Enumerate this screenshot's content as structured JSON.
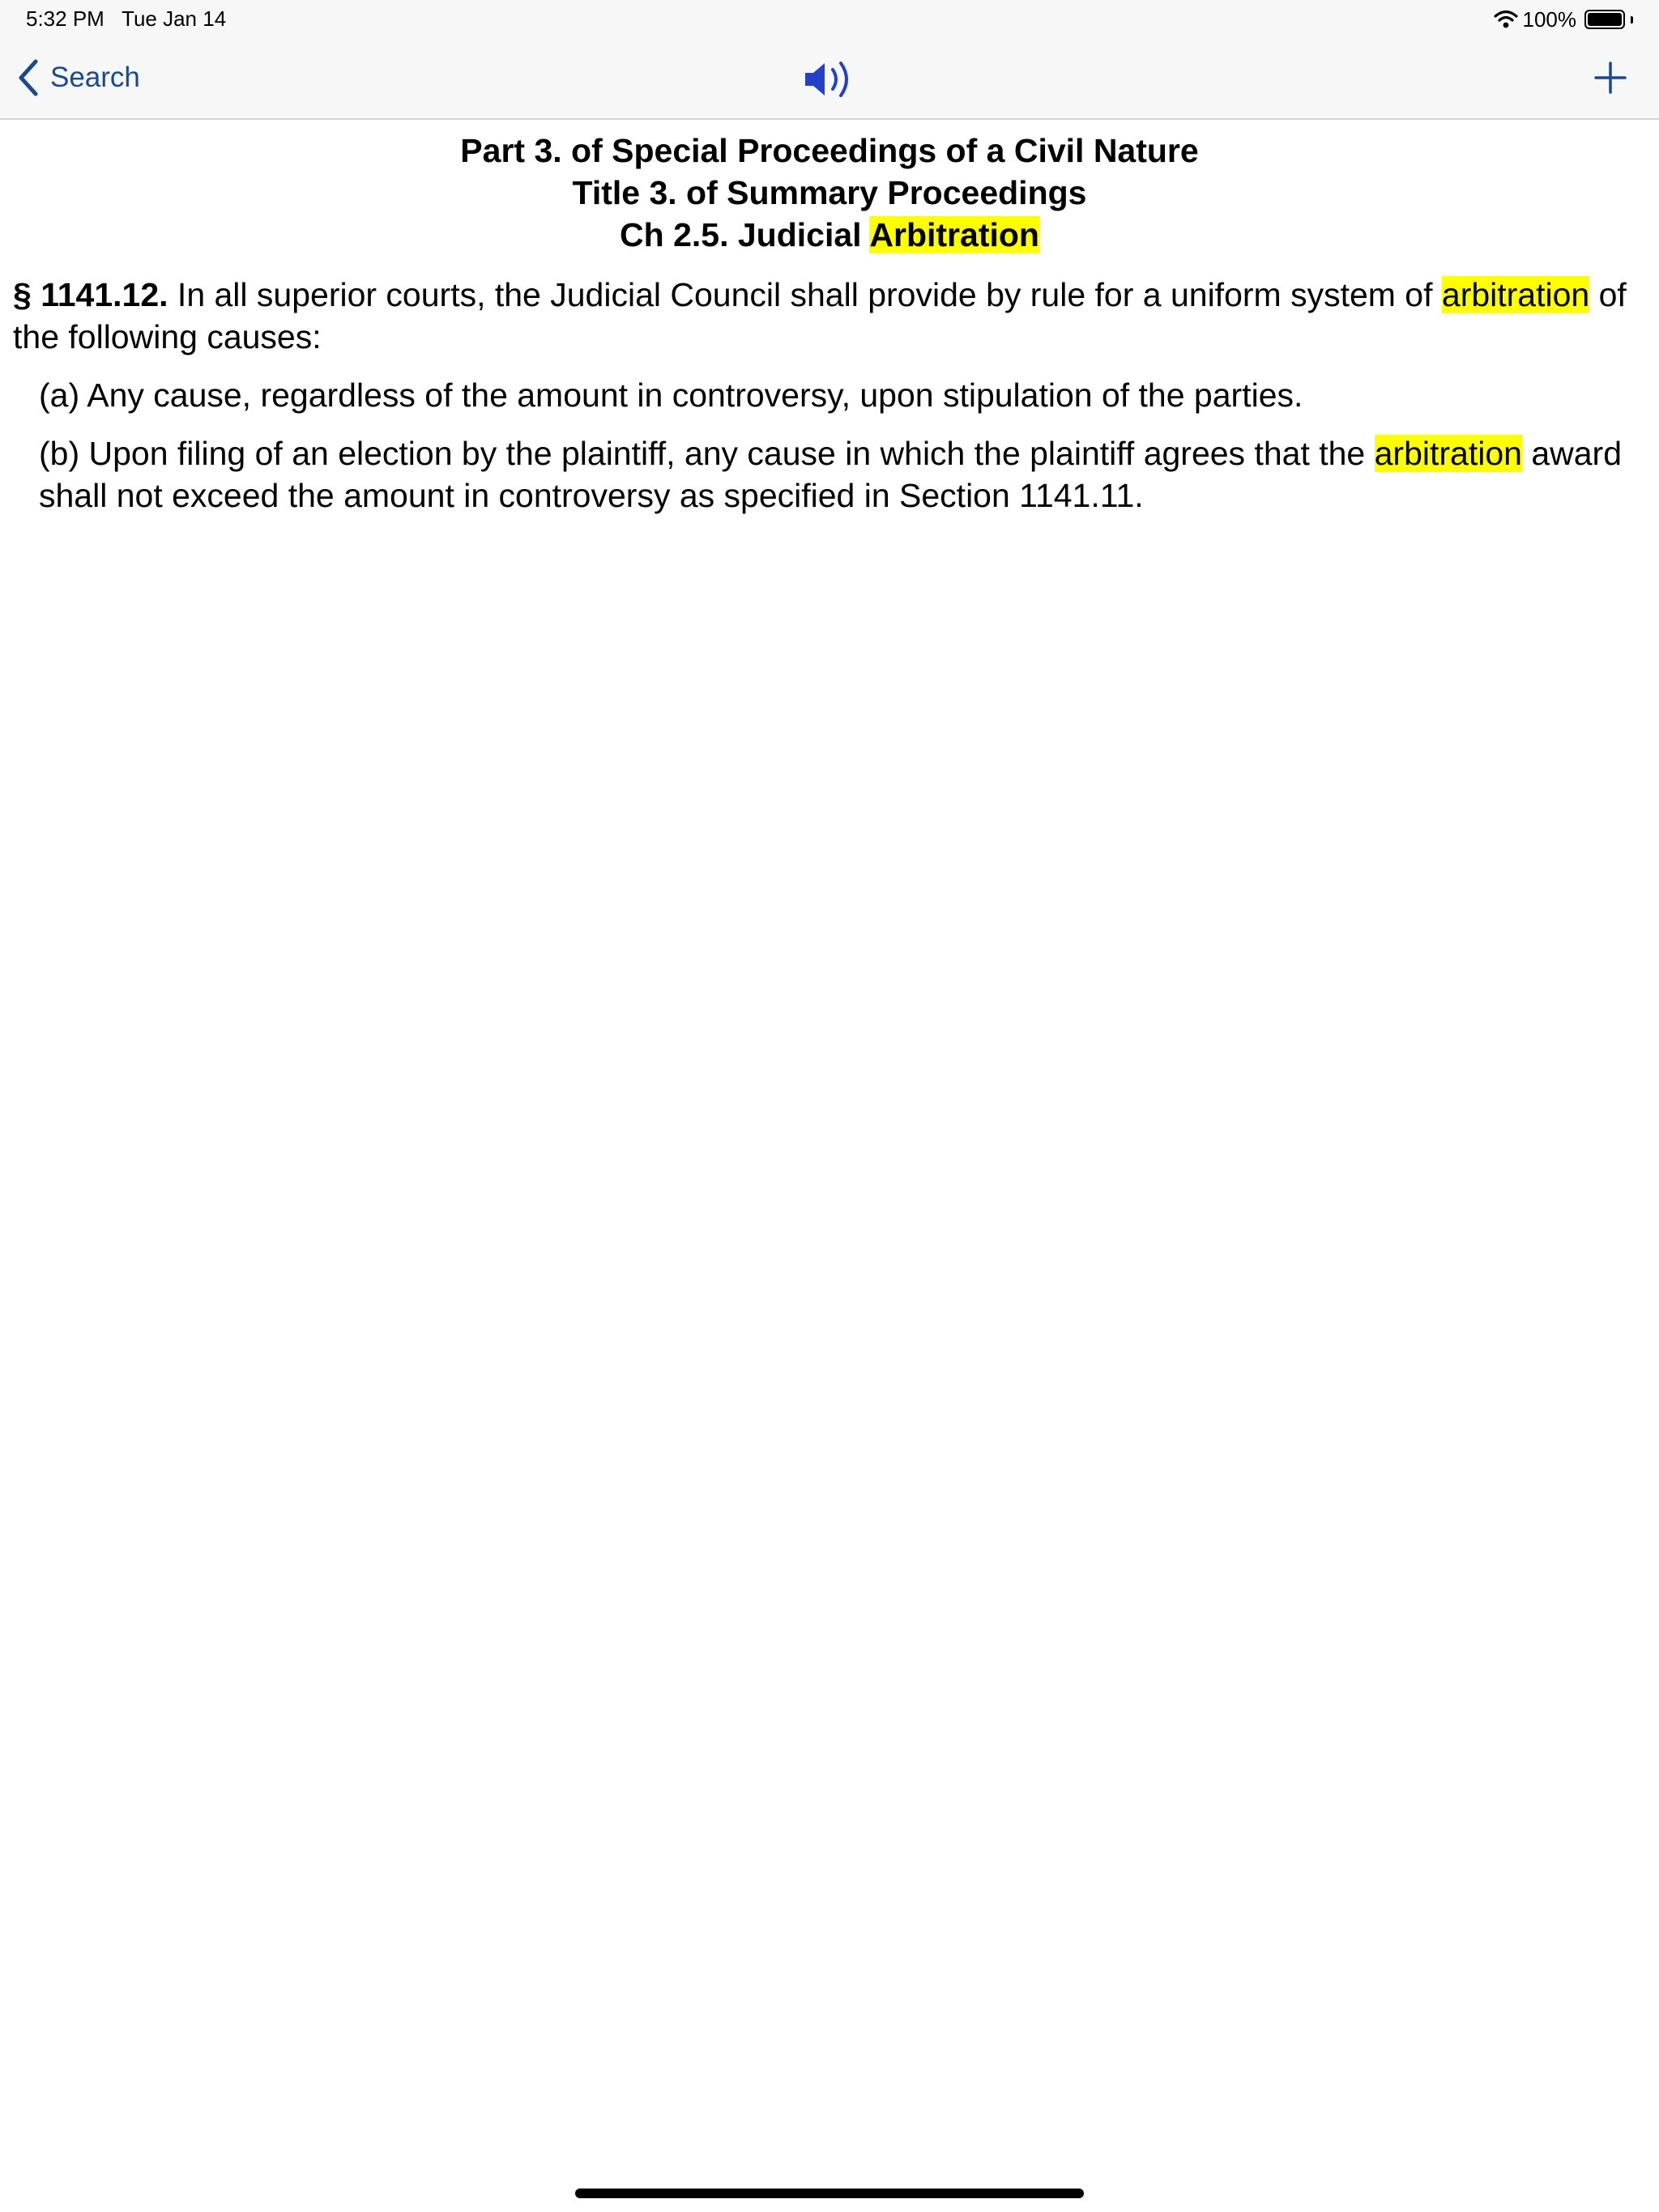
{
  "status_bar": {
    "time": "5:32 PM",
    "date": "Tue Jan 14",
    "battery_percent": "100%",
    "battery_level": 1.0
  },
  "nav": {
    "back_label": "Search",
    "speaker_icon": "speaker-icon",
    "add_icon": "plus-icon"
  },
  "document": {
    "heading_part": "Part 3. of Special Proceedings of a Civil Nature",
    "heading_title": "Title 3. of Summary Proceedings",
    "heading_chapter_prefix": "Ch 2.5. Judicial ",
    "heading_chapter_highlight": "Arbitration",
    "section_number": "§ 1141.12.",
    "section_text_before": " In all superior courts, the Judicial Council shall provide by rule for a uniform system of ",
    "section_highlight": "arbitration",
    "section_text_after": " of the following causes:",
    "sub_a": "(a) Any cause, regardless of the amount in controversy, upon stipulation of the parties.",
    "sub_b_before": "(b) Upon filing of an election by the plaintiff, any cause in which the plaintiff agrees that the ",
    "sub_b_highlight": "arbitration",
    "sub_b_after": " award shall not exceed the amount in controversy as specified in Section 1141.11."
  },
  "colors": {
    "highlight": "#ffff00",
    "accent": "#1a4a8c",
    "speaker": "#2340c8"
  }
}
